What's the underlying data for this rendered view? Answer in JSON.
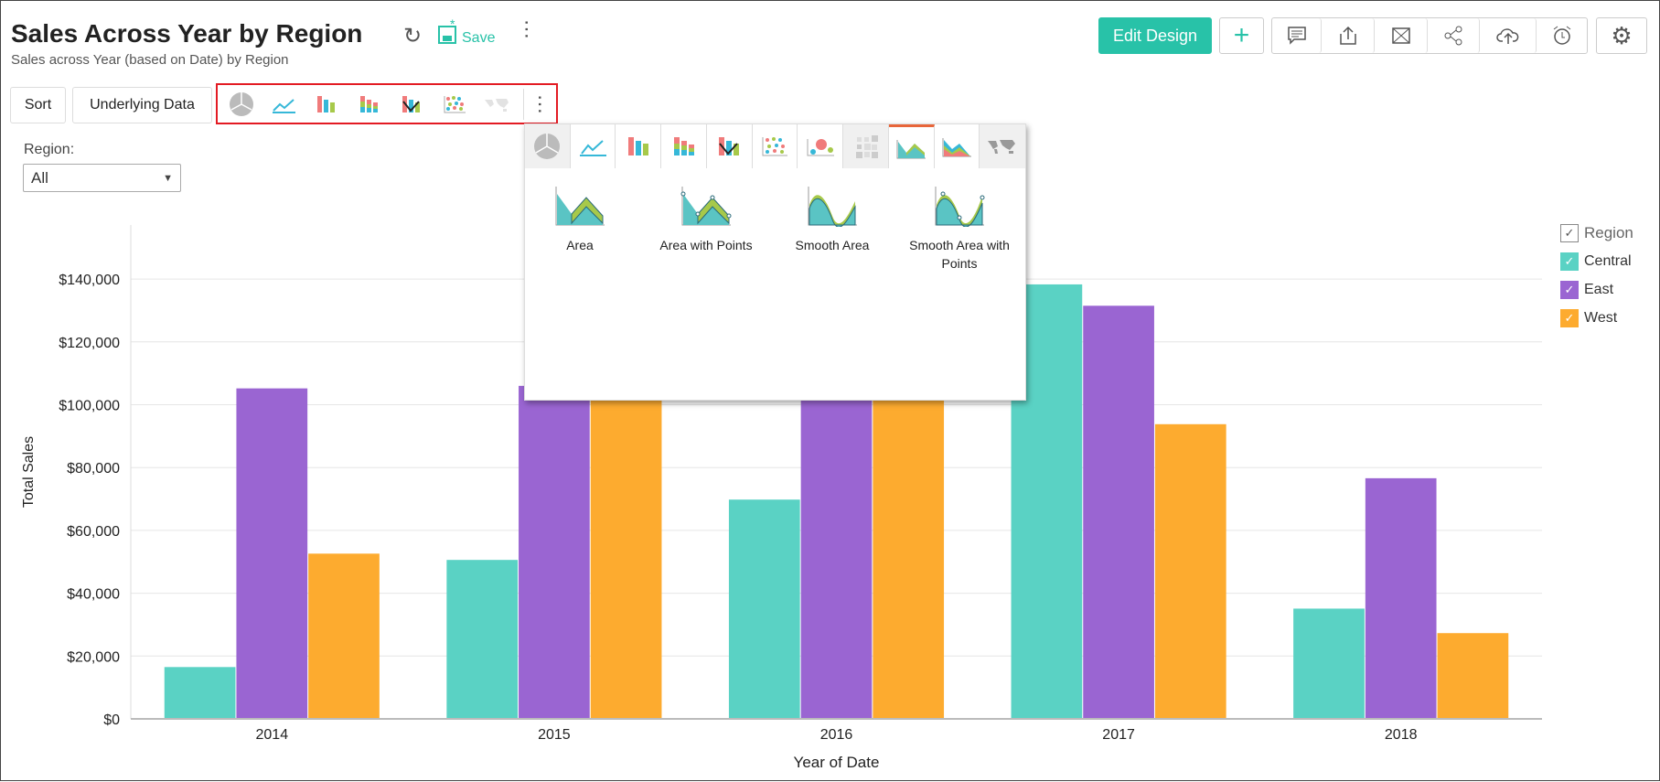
{
  "header": {
    "title": "Sales Across Year by Region",
    "subtitle": "Sales across Year (based on Date) by Region",
    "save_label": "Save",
    "edit_design_label": "Edit Design"
  },
  "toolbar": {
    "sort_label": "Sort",
    "underlying_label": "Underlying Data",
    "chart_type_icons": [
      "pie",
      "line",
      "bar",
      "stacked-bar",
      "combo",
      "scatter",
      "map"
    ]
  },
  "filter": {
    "label": "Region:",
    "value": "All"
  },
  "popup": {
    "tabs": [
      "pie",
      "line",
      "bar",
      "stacked-bar",
      "combo",
      "scatter",
      "bubble",
      "heatmap",
      "area",
      "stacked-area",
      "map"
    ],
    "selected_tab": "area",
    "options": [
      "Area",
      "Area with Points",
      "Smooth Area",
      "Smooth Area with",
      "Points"
    ]
  },
  "legend": {
    "title": "Region",
    "items": [
      "Central",
      "East",
      "West"
    ]
  },
  "colors": {
    "Central": "#5ad2c4",
    "East": "#9a65d2",
    "West": "#fdab2f",
    "accent": "#28c2a8"
  },
  "chart_data": {
    "type": "bar",
    "xlabel": "Year of Date",
    "ylabel": "Total Sales",
    "ylim": [
      0,
      160000
    ],
    "yticks": [
      "$0",
      "$20,000",
      "$40,000",
      "$60,000",
      "$80,000",
      "$100,000",
      "$120,000",
      "$140,000"
    ],
    "grid": true,
    "legend_placement": "right",
    "categories": [
      "2014",
      "2015",
      "2016",
      "2017",
      "2018"
    ],
    "series": [
      {
        "name": "Central",
        "values": [
          16500,
          50600,
          69800,
          138300,
          35100
        ]
      },
      {
        "name": "East",
        "values": [
          105200,
          106000,
          114000,
          131500,
          76600
        ]
      },
      {
        "name": "West",
        "values": [
          52600,
          110000,
          132000,
          93800,
          27300
        ]
      }
    ]
  }
}
